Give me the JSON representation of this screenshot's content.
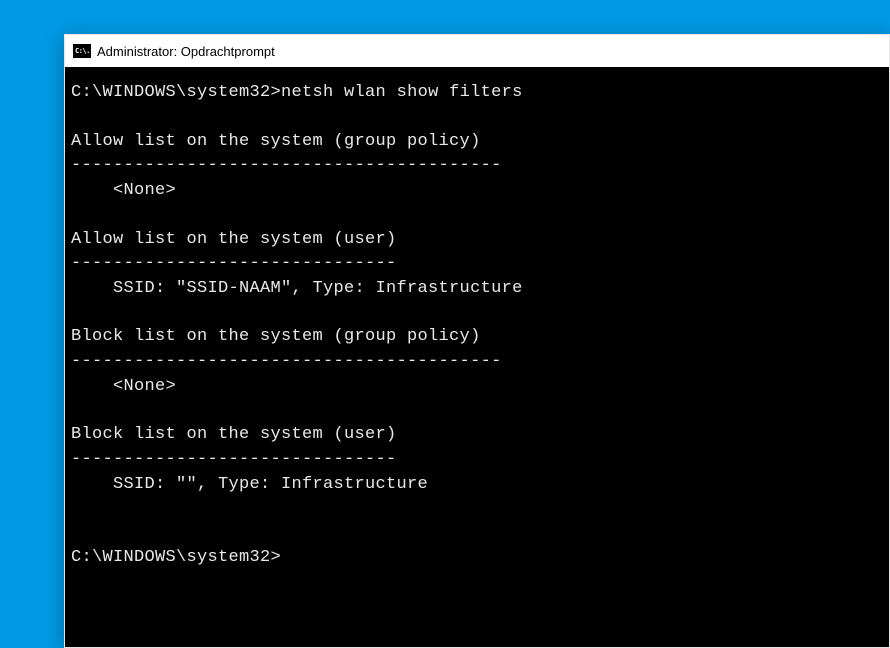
{
  "window": {
    "icon_text": "C:\\.",
    "title": "Administrator: Opdrachtprompt"
  },
  "terminal": {
    "prompt1": "C:\\WINDOWS\\system32>",
    "command": "netsh wlan show filters",
    "sections": {
      "allow_gp_header": "Allow list on the system (group policy)",
      "allow_gp_divider": "-----------------------------------------",
      "allow_gp_content": "    <None>",
      "allow_user_header": "Allow list on the system (user)",
      "allow_user_divider": "-------------------------------",
      "allow_user_content": "    SSID: \"SSID-NAAM\", Type: Infrastructure",
      "block_gp_header": "Block list on the system (group policy)",
      "block_gp_divider": "-----------------------------------------",
      "block_gp_content": "    <None>",
      "block_user_header": "Block list on the system (user)",
      "block_user_divider": "-------------------------------",
      "block_user_content": "    SSID: \"\", Type: Infrastructure"
    },
    "prompt2": "C:\\WINDOWS\\system32>"
  }
}
